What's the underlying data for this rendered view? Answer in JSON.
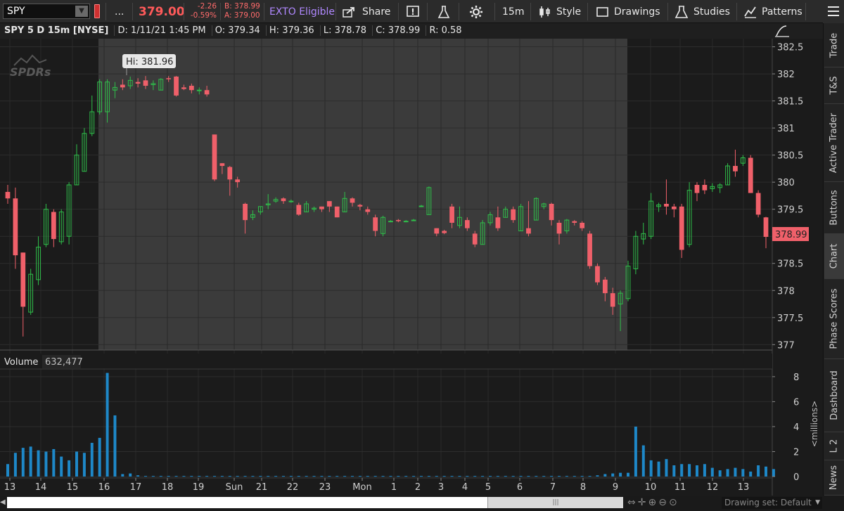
{
  "toolbar": {
    "symbol": "SPY",
    "more": "...",
    "last_price": "379.00",
    "change": "-2.26",
    "change_pct": "-0.59%",
    "bid": "B: 378.99",
    "ask": "A: 379.00",
    "exto": "EXTO Eligible",
    "share": "Share",
    "timeframe": "15m",
    "style": "Style",
    "drawings": "Drawings",
    "studies": "Studies",
    "patterns": "Patterns"
  },
  "infobar": {
    "symbol": "SPY 5 D 15m [NYSE]",
    "date": "D: 1/11/21 1:45 PM",
    "open": "O: 379.34",
    "high": "H: 379.36",
    "low": "L: 378.78",
    "close": "C: 378.99",
    "range": "R: 0.58"
  },
  "watermark": "SPDRs",
  "hi_label": "Hi: 381.96",
  "last_label": "378.99",
  "volume": {
    "label": "Volume",
    "value": "632,477",
    "unit": "<millions>"
  },
  "right_tabs": [
    "Trade",
    "T&S",
    "Active Trader",
    "Buttons",
    "Chart",
    "Phase Scores",
    "Dashboard",
    "L 2",
    "News"
  ],
  "active_tab": "Chart",
  "drawing_set": "Drawing set: Default",
  "colors": {
    "up": "#2fbf4a",
    "down": "#f0606a",
    "volume": "#1e88c8",
    "shade": "#3a3a3a"
  },
  "chart_data": {
    "type": "candlestick",
    "x_ticks": [
      "13",
      "14",
      "15",
      "16",
      "17",
      "18",
      "19",
      "Sun",
      "21",
      "22",
      "23",
      "Mon",
      "1",
      "2",
      "3",
      "4",
      "5",
      "6",
      "7",
      "8",
      "9",
      "10",
      "11",
      "12",
      "13"
    ],
    "y_ticks": [
      "382.5",
      "382",
      "381.5",
      "381",
      "380.5",
      "380",
      "379.5",
      "379",
      "378.5",
      "378",
      "377.5",
      "377"
    ],
    "ylim": [
      376.9,
      382.65
    ],
    "volume_ticks": [
      "8",
      "6",
      "4",
      "2",
      "0"
    ],
    "volume_ylim": [
      0,
      8.5
    ],
    "candles": [
      [
        379.82,
        379.7,
        379.95,
        379.6
      ],
      [
        379.7,
        378.65,
        379.9,
        378.4
      ],
      [
        378.7,
        377.7,
        378.7,
        377.15
      ],
      [
        377.6,
        378.3,
        378.4,
        377.55
      ],
      [
        378.2,
        378.8,
        379.0,
        378.1
      ],
      [
        378.85,
        379.5,
        379.6,
        378.8
      ],
      [
        379.45,
        378.95,
        379.5,
        378.8
      ],
      [
        378.9,
        379.45,
        379.5,
        378.85
      ],
      [
        379.0,
        379.95,
        380.0,
        378.85
      ],
      [
        379.95,
        380.5,
        380.7,
        379.95
      ],
      [
        380.2,
        380.9,
        381.0,
        380.2
      ],
      [
        380.9,
        381.3,
        381.6,
        380.85
      ],
      [
        381.3,
        381.85,
        381.9,
        381.25
      ],
      [
        381.3,
        381.85,
        381.9,
        381.1
      ],
      [
        381.7,
        381.75,
        381.85,
        381.55
      ],
      [
        381.8,
        381.75,
        381.9,
        381.7
      ],
      [
        381.78,
        381.88,
        381.95,
        381.72
      ],
      [
        381.85,
        381.82,
        381.92,
        381.75
      ],
      [
        381.88,
        381.78,
        381.96,
        381.72
      ],
      [
        381.8,
        381.82,
        381.88,
        381.7
      ],
      [
        381.7,
        381.9,
        381.92,
        381.7
      ],
      [
        381.92,
        381.9,
        381.96,
        381.85
      ],
      [
        381.95,
        381.6,
        381.96,
        381.58
      ],
      [
        381.75,
        381.72,
        381.8,
        381.7
      ],
      [
        381.78,
        381.7,
        381.82,
        381.64
      ],
      [
        381.7,
        381.7,
        381.75,
        381.62
      ],
      [
        381.7,
        381.62,
        381.78,
        381.58
      ],
      [
        380.88,
        380.05,
        380.88,
        380.02
      ],
      [
        380.35,
        380.3,
        380.35,
        380.15
      ],
      [
        380.28,
        380.05,
        380.3,
        379.75
      ],
      [
        380.05,
        380.0,
        380.1,
        379.9
      ],
      [
        379.6,
        379.3,
        379.62,
        379.05
      ],
      [
        379.35,
        379.4,
        379.48,
        379.3
      ],
      [
        379.45,
        379.55,
        379.55,
        379.4
      ],
      [
        379.58,
        379.6,
        379.78,
        379.5
      ],
      [
        379.65,
        379.68,
        379.72,
        379.62
      ],
      [
        379.7,
        379.65,
        379.72,
        379.6
      ],
      [
        379.65,
        379.65,
        379.68,
        379.62
      ],
      [
        379.58,
        379.4,
        379.62,
        379.38
      ],
      [
        379.45,
        379.6,
        379.65,
        379.45
      ],
      [
        379.5,
        379.52,
        379.55,
        379.45
      ],
      [
        379.55,
        379.5,
        379.55,
        379.45
      ],
      [
        379.65,
        379.55,
        379.65,
        379.45
      ],
      [
        379.55,
        379.35,
        379.55,
        379.35
      ],
      [
        379.45,
        379.7,
        379.82,
        379.45
      ],
      [
        379.7,
        379.62,
        379.72,
        379.55
      ],
      [
        379.58,
        379.55,
        379.6,
        379.48
      ],
      [
        379.5,
        379.45,
        379.55,
        379.4
      ],
      [
        379.35,
        379.1,
        379.4,
        379.0
      ],
      [
        379.05,
        379.35,
        379.38,
        379.0
      ],
      [
        379.28,
        379.28,
        379.3,
        379.26
      ],
      [
        379.3,
        379.28,
        379.32,
        379.26
      ],
      [
        379.28,
        379.28,
        379.3,
        379.26
      ],
      [
        379.3,
        379.3,
        379.32,
        379.28
      ],
      [
        379.55,
        379.56,
        379.58,
        379.54
      ],
      [
        379.4,
        379.9,
        379.92,
        379.4
      ],
      [
        379.15,
        379.05,
        379.15,
        379.0
      ],
      [
        379.1,
        379.06,
        379.12,
        379.04
      ],
      [
        379.55,
        379.25,
        379.6,
        379.15
      ],
      [
        379.2,
        379.35,
        379.55,
        379.15
      ],
      [
        379.3,
        379.15,
        379.35,
        379.1
      ],
      [
        379.05,
        378.85,
        379.1,
        378.8
      ],
      [
        378.85,
        379.25,
        379.3,
        378.85
      ],
      [
        379.25,
        379.4,
        379.45,
        379.2
      ],
      [
        379.35,
        379.15,
        379.55,
        379.1
      ],
      [
        379.35,
        379.5,
        379.55,
        379.35
      ],
      [
        379.5,
        379.3,
        379.55,
        379.25
      ],
      [
        379.1,
        379.55,
        379.6,
        379.1
      ],
      [
        379.15,
        379.05,
        379.65,
        379.0
      ],
      [
        379.3,
        379.7,
        379.72,
        379.3
      ],
      [
        379.55,
        379.6,
        379.62,
        379.5
      ],
      [
        379.6,
        379.3,
        379.62,
        379.2
      ],
      [
        379.25,
        379.05,
        379.3,
        378.85
      ],
      [
        379.1,
        379.3,
        379.32,
        379.05
      ],
      [
        379.28,
        379.25,
        379.3,
        379.2
      ],
      [
        379.25,
        379.15,
        379.28,
        379.1
      ],
      [
        379.05,
        378.45,
        379.1,
        378.4
      ],
      [
        378.45,
        378.15,
        378.5,
        378.1
      ],
      [
        378.2,
        377.95,
        378.25,
        377.8
      ],
      [
        377.95,
        377.7,
        378.05,
        377.55
      ],
      [
        377.75,
        377.95,
        378.0,
        377.25
      ],
      [
        377.85,
        378.45,
        378.55,
        377.8
      ],
      [
        378.4,
        379.0,
        379.1,
        378.3
      ],
      [
        378.95,
        379.05,
        379.25,
        378.85
      ],
      [
        379.0,
        379.65,
        379.8,
        378.95
      ],
      [
        379.55,
        379.58,
        379.62,
        379.45
      ],
      [
        379.6,
        379.55,
        380.05,
        379.4
      ],
      [
        379.55,
        379.5,
        379.6,
        379.35
      ],
      [
        379.55,
        378.75,
        379.6,
        378.6
      ],
      [
        378.85,
        379.85,
        380.0,
        378.8
      ],
      [
        379.95,
        379.8,
        380.0,
        379.65
      ],
      [
        379.95,
        379.85,
        380.05,
        379.78
      ],
      [
        379.88,
        379.92,
        379.98,
        379.82
      ],
      [
        379.9,
        379.95,
        379.98,
        379.8
      ],
      [
        379.95,
        380.3,
        380.35,
        379.95
      ],
      [
        380.3,
        380.2,
        380.6,
        380.1
      ],
      [
        380.35,
        380.45,
        380.5,
        380.3
      ],
      [
        380.45,
        379.8,
        380.5,
        379.8
      ],
      [
        379.8,
        379.4,
        379.85,
        379.35
      ],
      [
        379.35,
        378.99,
        379.36,
        378.78
      ]
    ],
    "volumes": [
      1.0,
      1.9,
      2.3,
      2.4,
      2.1,
      2.0,
      2.2,
      1.6,
      1.3,
      2.0,
      1.9,
      2.7,
      3.1,
      8.3,
      4.9,
      0.2,
      0.25,
      0.1,
      0.05,
      0.05,
      0.05,
      0.05,
      0.05,
      0.05,
      0.05,
      0.05,
      0.05,
      0.05,
      0.05,
      0.05,
      0.05,
      0.05,
      0.05,
      0.05,
      0.05,
      0.05,
      0.05,
      0.05,
      0.05,
      0.05,
      0.05,
      0.05,
      0.05,
      0.05,
      0.05,
      0.05,
      0.05,
      0.05,
      0.05,
      0.05,
      0.05,
      0.05,
      0.05,
      0.05,
      0.05,
      0.05,
      0.05,
      0.05,
      0.05,
      0.05,
      0.05,
      0.05,
      0.05,
      0.05,
      0.05,
      0.05,
      0.05,
      0.05,
      0.05,
      0.05,
      0.05,
      0.05,
      0.05,
      0.05,
      0.05,
      0.05,
      0.05,
      0.1,
      0.2,
      0.25,
      0.3,
      0.3,
      4.0,
      2.5,
      1.3,
      1.2,
      1.4,
      0.9,
      1.0,
      1.0,
      0.9,
      1.0,
      0.7,
      0.5,
      0.6,
      0.7,
      0.6,
      0.4,
      0.9,
      0.8,
      0.6
    ]
  }
}
